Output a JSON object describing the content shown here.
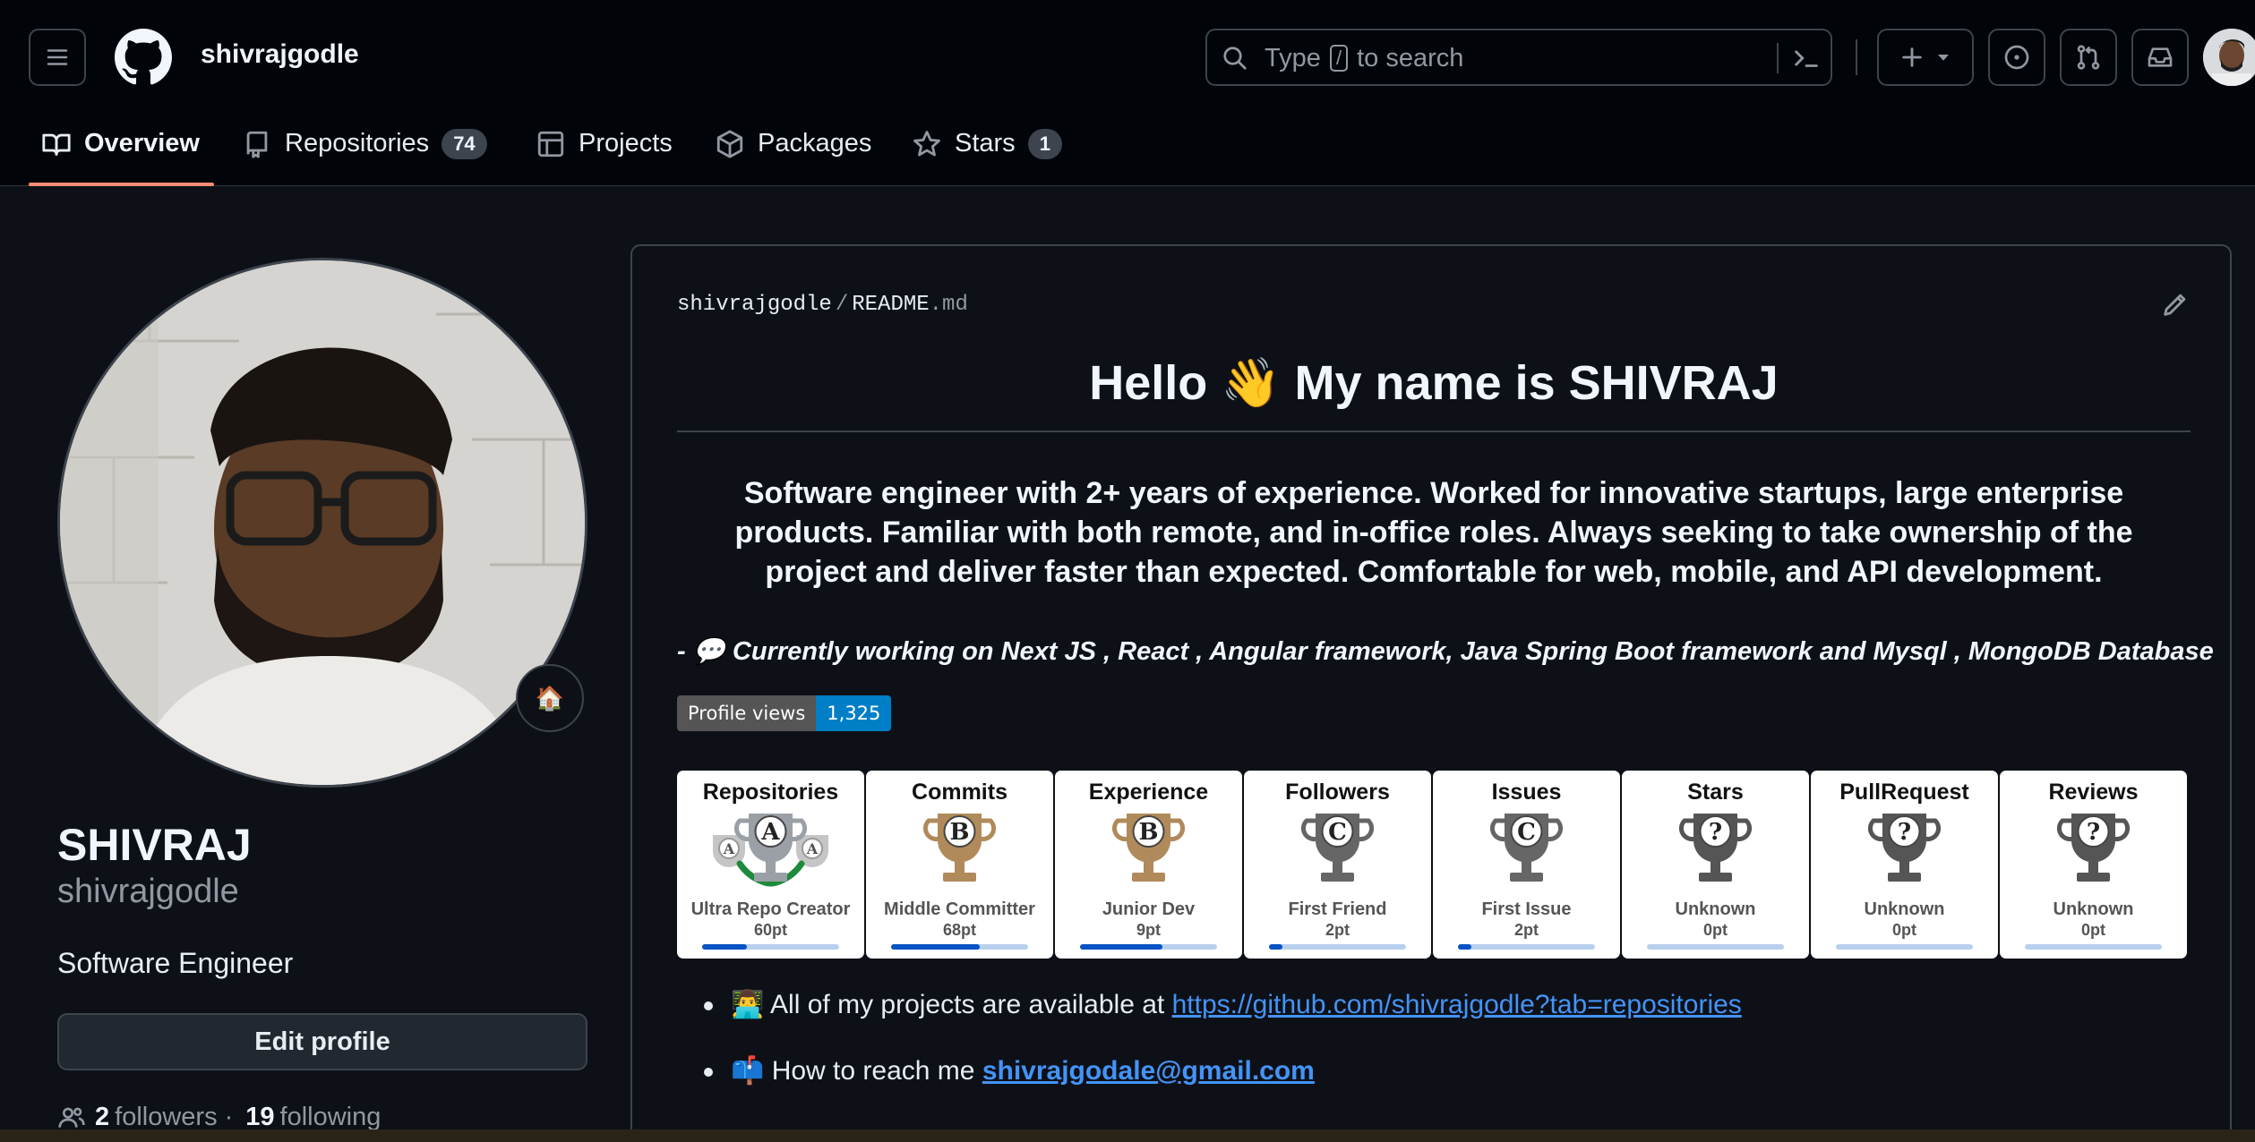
{
  "header": {
    "username": "shivrajgodle",
    "search": {
      "prefix": "Type",
      "key": "/",
      "suffix": "to search"
    }
  },
  "tabs": [
    {
      "label": "Overview",
      "icon": "book-icon"
    },
    {
      "label": "Repositories",
      "icon": "repo-icon",
      "count": "74"
    },
    {
      "label": "Projects",
      "icon": "table-icon"
    },
    {
      "label": "Packages",
      "icon": "package-icon"
    },
    {
      "label": "Stars",
      "icon": "star-icon",
      "count": "1"
    }
  ],
  "profile": {
    "status_emoji": "🏠",
    "name": "SHIVRAJ",
    "login": "shivrajgodle",
    "bio": "Software Engineer",
    "edit_label": "Edit profile",
    "followers_count": "2",
    "followers_label": "followers",
    "sep": "·",
    "following_count": "19",
    "following_label": "following"
  },
  "readme": {
    "path_owner": "shivrajgodle",
    "path_sep": "/",
    "path_file": "README",
    "path_ext": ".md",
    "heading": "Hello 👋 My name is SHIVRAJ",
    "intro": "Software engineer with 2+ years of experience. Worked for innovative startups, large enterprise products. Familiar with both remote, and in-office roles. Always seeking to take ownership of the project and deliver faster than expected. Comfortable for web, mobile, and API development.",
    "working": "- 💬 Currently working on Next JS , React , Angular framework, Java Spring Boot framework and Mysql , MongoDB Database",
    "badge_label": "Profile views",
    "badge_value": "1,325",
    "trophies": [
      {
        "title": "Repositories",
        "rank": "A",
        "name": "Ultra Repo Creator",
        "pt": "60pt",
        "progress": 0.33
      },
      {
        "title": "Commits",
        "rank": "B",
        "name": "Middle Committer",
        "pt": "68pt",
        "progress": 0.65
      },
      {
        "title": "Experience",
        "rank": "B",
        "name": "Junior Dev",
        "pt": "9pt",
        "progress": 0.6
      },
      {
        "title": "Followers",
        "rank": "C",
        "name": "First Friend",
        "pt": "2pt",
        "progress": 0.1
      },
      {
        "title": "Issues",
        "rank": "C",
        "name": "First Issue",
        "pt": "2pt",
        "progress": 0.1
      },
      {
        "title": "Stars",
        "rank": "?",
        "name": "Unknown",
        "pt": "0pt",
        "progress": 0
      },
      {
        "title": "PullRequest",
        "rank": "?",
        "name": "Unknown",
        "pt": "0pt",
        "progress": 0
      },
      {
        "title": "Reviews",
        "rank": "?",
        "name": "Unknown",
        "pt": "0pt",
        "progress": 0
      }
    ],
    "items": [
      {
        "emoji": "👨‍💻",
        "text": "All of my projects are available at",
        "link": "https://github.com/shivrajgodle?tab=repositories"
      },
      {
        "emoji": "📫",
        "text": "How to reach me",
        "link": "shivrajgodale@gmail.com"
      }
    ]
  },
  "colors": {
    "accent_underline": "#fd8c73",
    "link": "#4493f8",
    "rank_A": "#9aa0a6",
    "rank_B": "#b08a5a",
    "rank_C": "#666666",
    "rank_unknown": "#555555"
  }
}
